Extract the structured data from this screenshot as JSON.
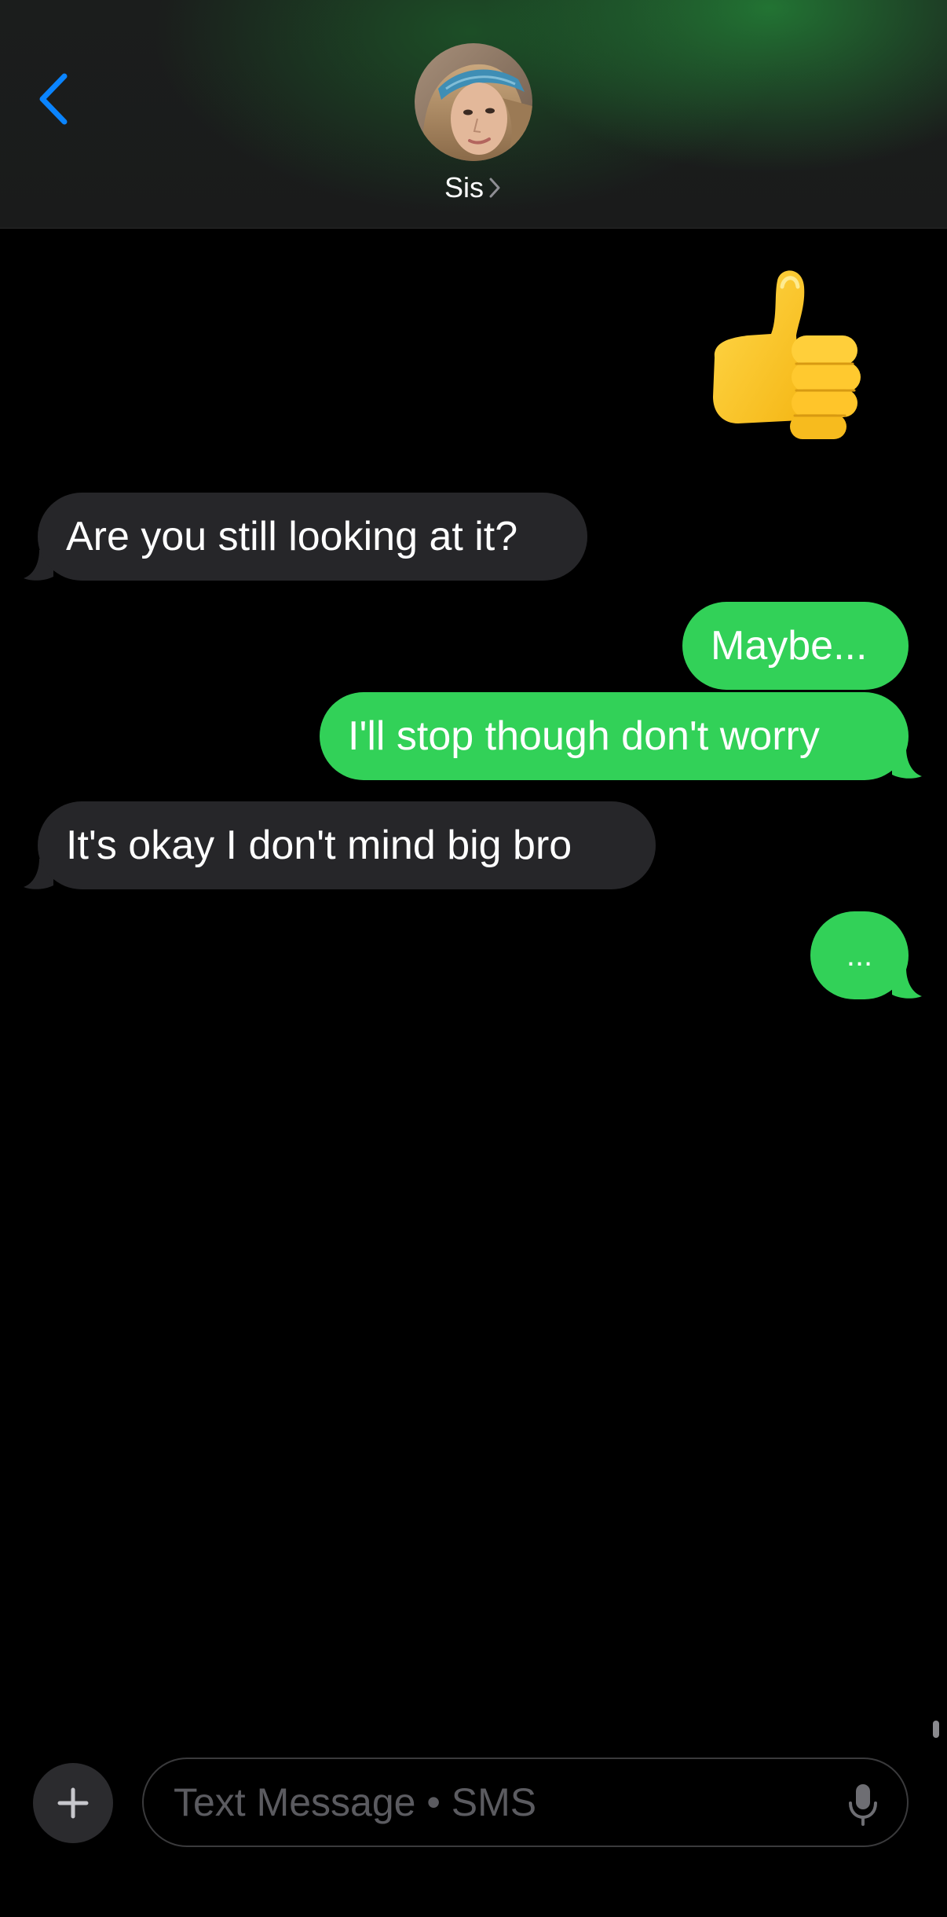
{
  "header": {
    "contact_name": "Sis",
    "back_icon": "chevron-left-icon",
    "name_chevron_icon": "chevron-right-icon"
  },
  "messages": [
    {
      "direction": "outgoing",
      "type": "emoji",
      "text": "👍"
    },
    {
      "direction": "incoming",
      "type": "text",
      "text": "Are you still looking at it?"
    },
    {
      "direction": "outgoing",
      "type": "text",
      "text": "Maybe..."
    },
    {
      "direction": "outgoing",
      "type": "text",
      "text": "I'll stop though don't worry"
    },
    {
      "direction": "incoming",
      "type": "text",
      "text": "It's okay I don't mind big bro"
    },
    {
      "direction": "outgoing",
      "type": "text",
      "text": "..."
    }
  ],
  "composer": {
    "placeholder": "Text Message • SMS",
    "plus_icon": "plus-icon",
    "mic_icon": "microphone-icon"
  },
  "colors": {
    "outgoing_bubble": "#32d158",
    "incoming_bubble": "#262629",
    "accent_blue": "#0a84ff",
    "background": "#000000"
  }
}
